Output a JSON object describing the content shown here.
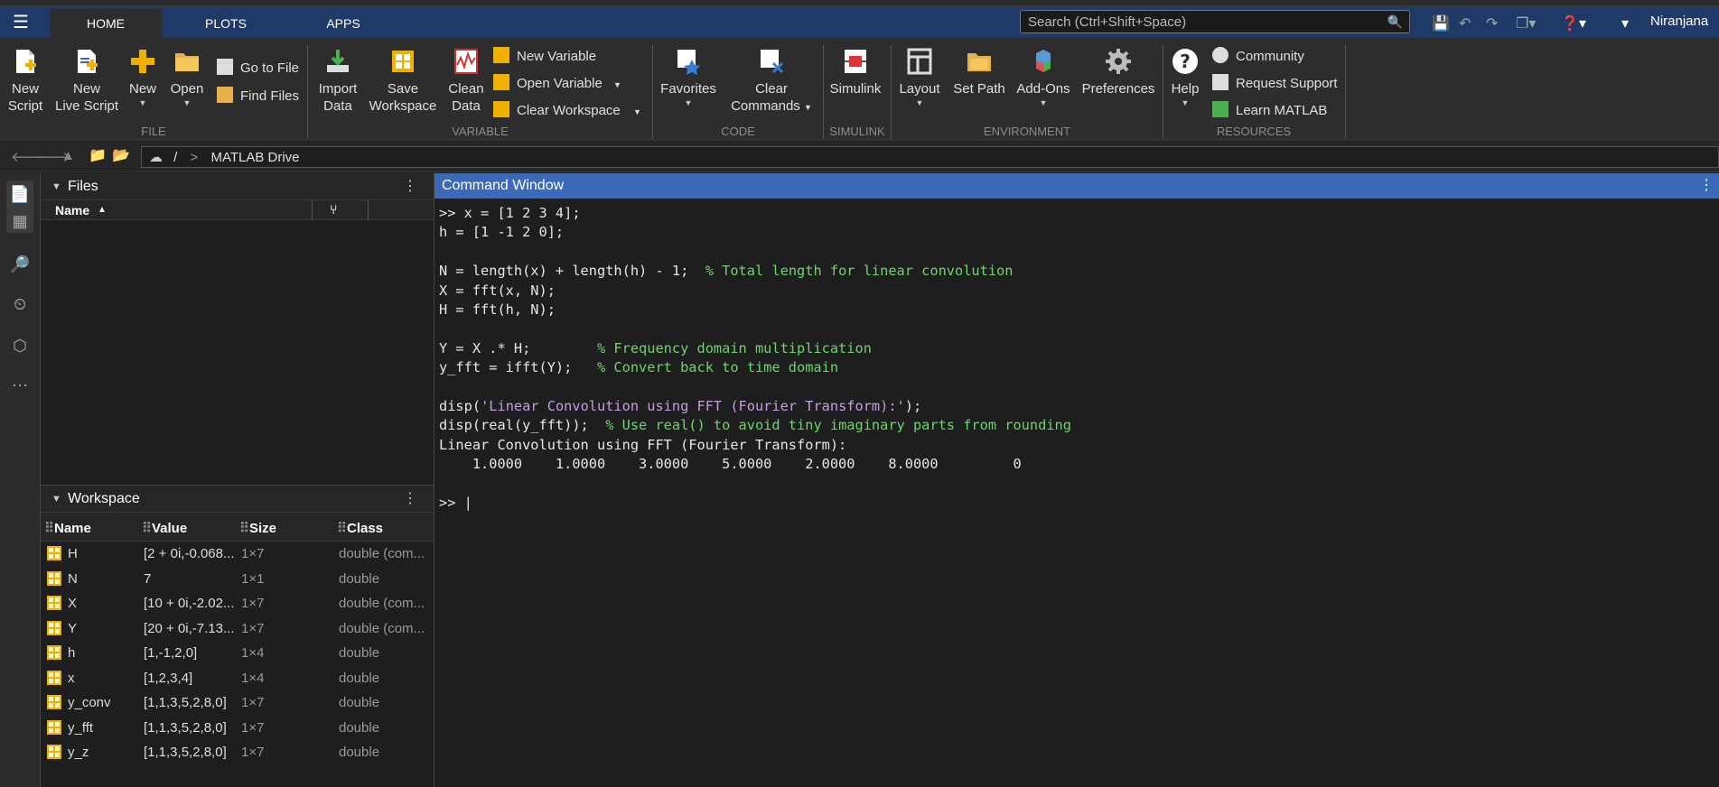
{
  "tabs": {
    "home": "HOME",
    "plots": "PLOTS",
    "apps": "APPS"
  },
  "search_placeholder": "Search (Ctrl+Shift+Space)",
  "user": "Niranjana",
  "ribbon": {
    "file": {
      "new_script": [
        "New",
        "Script"
      ],
      "new_live_script": [
        "New",
        "Live Script"
      ],
      "new": "New",
      "open": "Open",
      "go_to_file": "Go to File",
      "find_files": "Find Files",
      "label": "FILE"
    },
    "variable": {
      "import_data": [
        "Import",
        "Data"
      ],
      "save_workspace": [
        "Save",
        "Workspace"
      ],
      "clean_data": [
        "Clean",
        "Data"
      ],
      "new_variable": "New Variable",
      "open_variable": "Open Variable",
      "clear_workspace": "Clear Workspace",
      "label": "VARIABLE"
    },
    "code": {
      "favorites": "Favorites",
      "clear_commands": [
        "Clear",
        "Commands"
      ],
      "label": "CODE"
    },
    "simulink": {
      "simulink": "Simulink",
      "label": "SIMULINK"
    },
    "environment": {
      "layout": "Layout",
      "set_path": "Set Path",
      "add_ons": "Add-Ons",
      "preferences": "Preferences",
      "label": "ENVIRONMENT"
    },
    "resources": {
      "help": "Help",
      "community": "Community",
      "request_support": "Request Support",
      "learn_matlab": "Learn MATLAB",
      "label": "RESOURCES"
    }
  },
  "address": {
    "root": "/",
    "sep": ">",
    "folder": "MATLAB Drive"
  },
  "files_panel": {
    "title": "Files",
    "col_name": "Name"
  },
  "workspace_panel": {
    "title": "Workspace",
    "columns": [
      "Name",
      "Value",
      "Size",
      "Class"
    ],
    "rows": [
      {
        "name": "H",
        "value": "[2 + 0i,-0.068...",
        "size": "1×7",
        "class": "double (com..."
      },
      {
        "name": "N",
        "value": "7",
        "size": "1×1",
        "class": "double"
      },
      {
        "name": "X",
        "value": "[10 + 0i,-2.02...",
        "size": "1×7",
        "class": "double (com..."
      },
      {
        "name": "Y",
        "value": "[20 + 0i,-7.13...",
        "size": "1×7",
        "class": "double (com..."
      },
      {
        "name": "h",
        "value": "[1,-1,2,0]",
        "size": "1×4",
        "class": "double"
      },
      {
        "name": "x",
        "value": "[1,2,3,4]",
        "size": "1×4",
        "class": "double"
      },
      {
        "name": "y_conv",
        "value": "[1,1,3,5,2,8,0]",
        "size": "1×7",
        "class": "double"
      },
      {
        "name": "y_fft",
        "value": "[1,1,3,5,2,8,0]",
        "size": "1×7",
        "class": "double"
      },
      {
        "name": "y_z",
        "value": "[1,1,3,5,2,8,0]",
        "size": "1×7",
        "class": "double"
      }
    ]
  },
  "command_window": {
    "title": "Command Window",
    "lines": [
      {
        "code": ">> x = [1 2 3 4];"
      },
      {
        "code": "h = [1 -1 2 0];"
      },
      {
        "code": ""
      },
      {
        "code": "N = length(x) + length(h) - 1;  ",
        "comment": "% Total length for linear convolution"
      },
      {
        "code": "X = fft(x, N);"
      },
      {
        "code": "H = fft(h, N);"
      },
      {
        "code": ""
      },
      {
        "code": "Y = X .* H;        ",
        "comment": "% Frequency domain multiplication"
      },
      {
        "code": "y_fft = ifft(Y);   ",
        "comment": "% Convert back to time domain"
      },
      {
        "code": ""
      },
      {
        "code": "disp(",
        "string": "'Linear Convolution using FFT (Fourier Transform):'",
        "tail": ");"
      },
      {
        "code": "disp(real(y_fft));  ",
        "comment": "% Use real() to avoid tiny imaginary parts from rounding"
      },
      {
        "code": "Linear Convolution using FFT (Fourier Transform):"
      },
      {
        "code": "    1.0000    1.0000    3.0000    5.0000    2.0000    8.0000         0"
      },
      {
        "code": ""
      },
      {
        "code": ">> |"
      }
    ]
  }
}
